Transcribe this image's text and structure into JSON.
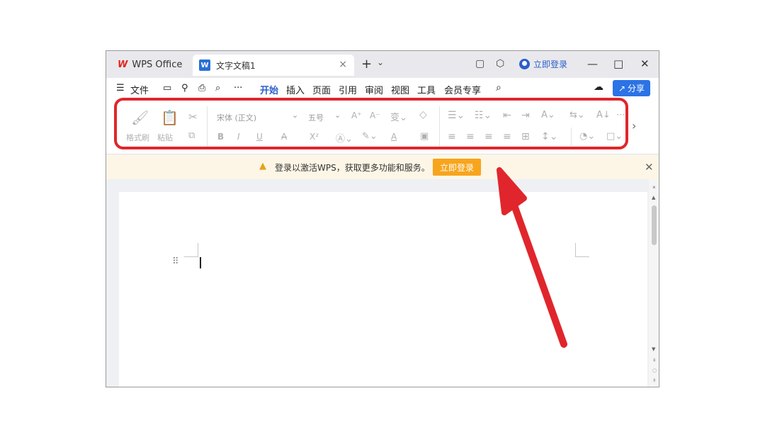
{
  "titlebar": {
    "app_tab": "WPS Office",
    "app_logo": "W",
    "doc_tab": "文字文稿1",
    "doc_icon": "W",
    "close_glyph": "×",
    "add_glyph": "+",
    "dropdown_glyph": "⌄",
    "login": "立即登录",
    "minimize": "—",
    "maximize": "□",
    "close": "✕"
  },
  "menu": {
    "hamburger": "☰",
    "file": "文件",
    "more": "···",
    "tabs": [
      "开始",
      "插入",
      "页面",
      "引用",
      "审阅",
      "视图",
      "工具",
      "会员专享"
    ],
    "active_tab": "开始",
    "share": "分享"
  },
  "ribbon": {
    "format_painter": "格式刷",
    "paste": "粘贴",
    "font_name": "宋体 (正文)",
    "font_size": "五号",
    "bold": "B",
    "italic": "I",
    "underline": "U",
    "strike": "A",
    "superscript": "X²",
    "font_color": "A",
    "grow": "A⁺",
    "shrink": "A⁻",
    "more_arrow": "›"
  },
  "notice": {
    "icon": "warning-icon",
    "text": "登录以激活WPS，获取更多功能和服务。",
    "button": "立即登录",
    "close": "✕"
  },
  "document": {
    "drag_handle": "⠿"
  },
  "colors": {
    "accent": "#2b73e6",
    "highlight": "#e0262c",
    "notice_button": "#f7a51c",
    "wps_red": "#e0261e"
  }
}
